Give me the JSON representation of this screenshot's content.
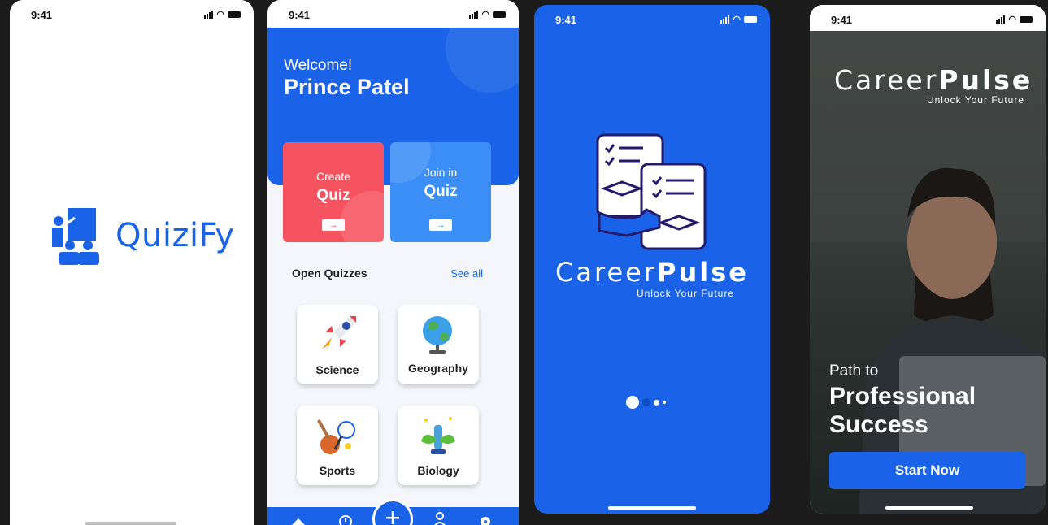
{
  "status_time": "9:41",
  "quizify": {
    "logo_text": "QuiziFy"
  },
  "dashboard": {
    "welcome": "Welcome!",
    "name": "Prince Patel",
    "create_line1": "Create",
    "create_line2": "Quiz",
    "join_line1": "Join in",
    "join_line2": "Quiz",
    "arrow": "→",
    "section_title": "Open Quizzes",
    "see_all": "See all",
    "categories": [
      {
        "label": "Science",
        "icon": "rocket-icon"
      },
      {
        "label": "Geography",
        "icon": "globe-icon"
      },
      {
        "label": "Sports",
        "icon": "sports-icon"
      },
      {
        "label": "Biology",
        "icon": "plant-icon"
      }
    ],
    "fab": "+",
    "nav_icons": [
      "home-icon",
      "history-icon",
      "profile-icon",
      "settings-icon"
    ]
  },
  "splash": {
    "brand_light": "Career",
    "brand_bold": "Pulse",
    "tagline": "Unlock Your Future"
  },
  "onboarding": {
    "brand_light": "Career",
    "brand_bold": "Pulse",
    "tagline": "Unlock Your Future",
    "path_to": "Path to",
    "headline": "Professional Success",
    "button": "Start Now"
  },
  "colors": {
    "primary": "#1a63e8",
    "create_card": "#f5535f",
    "join_card": "#3b8ef5"
  }
}
